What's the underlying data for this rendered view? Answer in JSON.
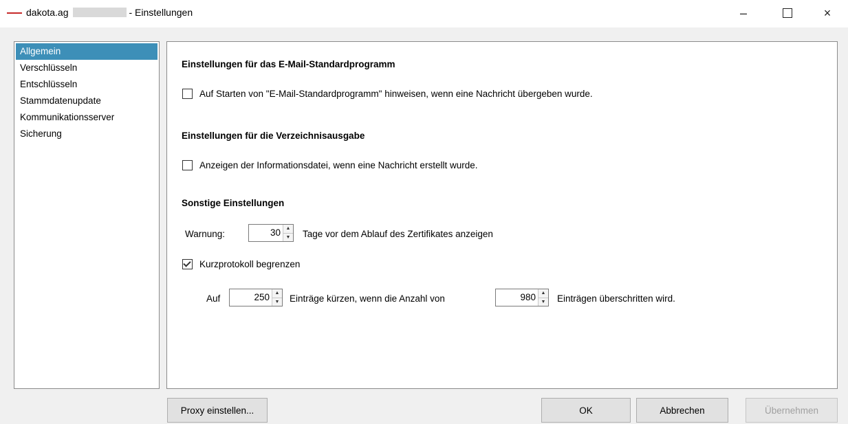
{
  "window": {
    "app_name": "dakota.ag",
    "title_suffix": "- Einstellungen",
    "controls": {
      "minimize": "–",
      "close": "×"
    }
  },
  "sidebar": {
    "items": [
      {
        "label": "Allgemein",
        "selected": true
      },
      {
        "label": "Verschlüsseln",
        "selected": false
      },
      {
        "label": "Entschlüsseln",
        "selected": false
      },
      {
        "label": "Stammdatenupdate",
        "selected": false
      },
      {
        "label": "Kommunikationsserver",
        "selected": false
      },
      {
        "label": "Sicherung",
        "selected": false
      }
    ]
  },
  "main": {
    "email_section": {
      "title": "Einstellungen für das E-Mail-Standardprogramm",
      "checkbox_label": "Auf Starten von \"E-Mail-Standardprogramm\" hinweisen, wenn eine Nachricht übergeben wurde.",
      "checked": false
    },
    "directory_section": {
      "title": "Einstellungen für die Verzeichnisausgabe",
      "checkbox_label": "Anzeigen der Informationsdatei, wenn eine Nachricht erstellt wurde.",
      "checked": false
    },
    "other_section": {
      "title": "Sonstige Einstellungen",
      "warning_label": "Warnung:",
      "warning_value": "30",
      "warning_suffix": "Tage vor dem Ablauf des Zertifikates anzeigen",
      "protocol_checkbox_label": "Kurzprotokoll begrenzen",
      "protocol_checked": true,
      "auf_label": "Auf",
      "entries_value": "250",
      "entries_mid": "Einträge kürzen, wenn die Anzahl von",
      "limit_value": "980",
      "limit_suffix": "Einträgen überschritten wird."
    }
  },
  "footer": {
    "proxy_label": "Proxy einstellen...",
    "ok_label": "OK",
    "cancel_label": "Abbrechen",
    "apply_label": "Übernehmen"
  },
  "colors": {
    "selection": "#3d8fb8",
    "logo": "#c62828"
  }
}
